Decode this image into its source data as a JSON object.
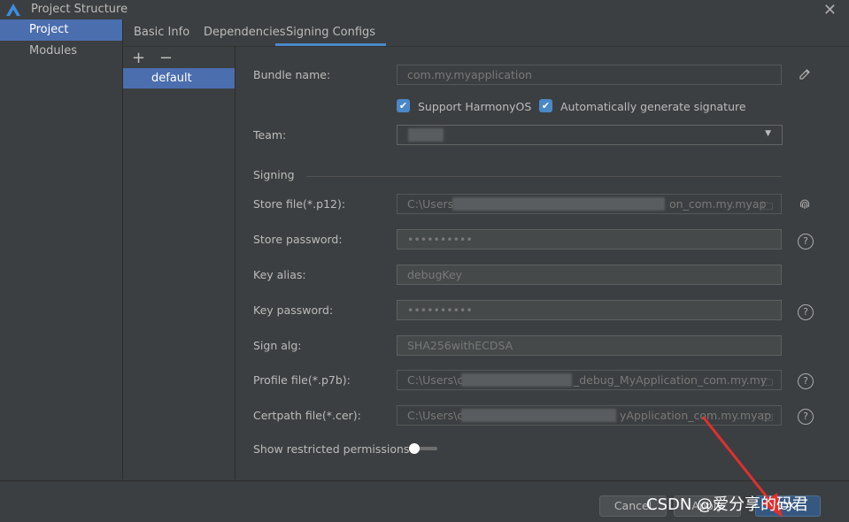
{
  "window": {
    "title": "Project Structure"
  },
  "nav": {
    "items": [
      {
        "label": "Project"
      },
      {
        "label": "Modules"
      }
    ]
  },
  "tabs": [
    {
      "label": "Basic Info"
    },
    {
      "label": "Dependencies"
    },
    {
      "label": "Signing Configs"
    }
  ],
  "config_list": {
    "add": "+",
    "remove": "−",
    "items": [
      {
        "label": "default"
      }
    ]
  },
  "form": {
    "bundle_name": {
      "label": "Bundle name:",
      "value": "com.my.myapplication"
    },
    "support_harmonyos": {
      "label": "Support HarmonyOS",
      "checked": true
    },
    "auto_sign": {
      "label": "Automatically generate signature",
      "checked": true
    },
    "team": {
      "label": "Team:"
    },
    "signing_section": "Signing",
    "store_file": {
      "label": "Store file(*.p12):",
      "value_start": "C:\\Users\\",
      "value_end": "on_com.my.myap"
    },
    "store_password": {
      "label": "Store password:",
      "value": "••••••••••"
    },
    "key_alias": {
      "label": "Key alias:",
      "value": "debugKey"
    },
    "key_password": {
      "label": "Key password:",
      "value": "••••••••••"
    },
    "sign_alg": {
      "label": "Sign alg:",
      "value": "SHA256withECDSA"
    },
    "profile_file": {
      "label": "Profile file(*.p7b):",
      "value_start": "C:\\Users\\c",
      "value_end": "_debug_MyApplication_com.my.my"
    },
    "certpath_file": {
      "label": "Certpath file(*.cer):",
      "value_start": "C:\\Users\\c",
      "value_end": "yApplication_com.my.myap"
    },
    "restricted": {
      "label": "Show restricted permissions"
    }
  },
  "footer": {
    "cancel": "Cancel",
    "apply": "Apply",
    "ok": "OK"
  },
  "watermark": "CSDN @爱分享的码君",
  "colors": {
    "accent": "#4b6eaf",
    "checkbox": "#4a88c7",
    "arrow": "#e0302e"
  }
}
